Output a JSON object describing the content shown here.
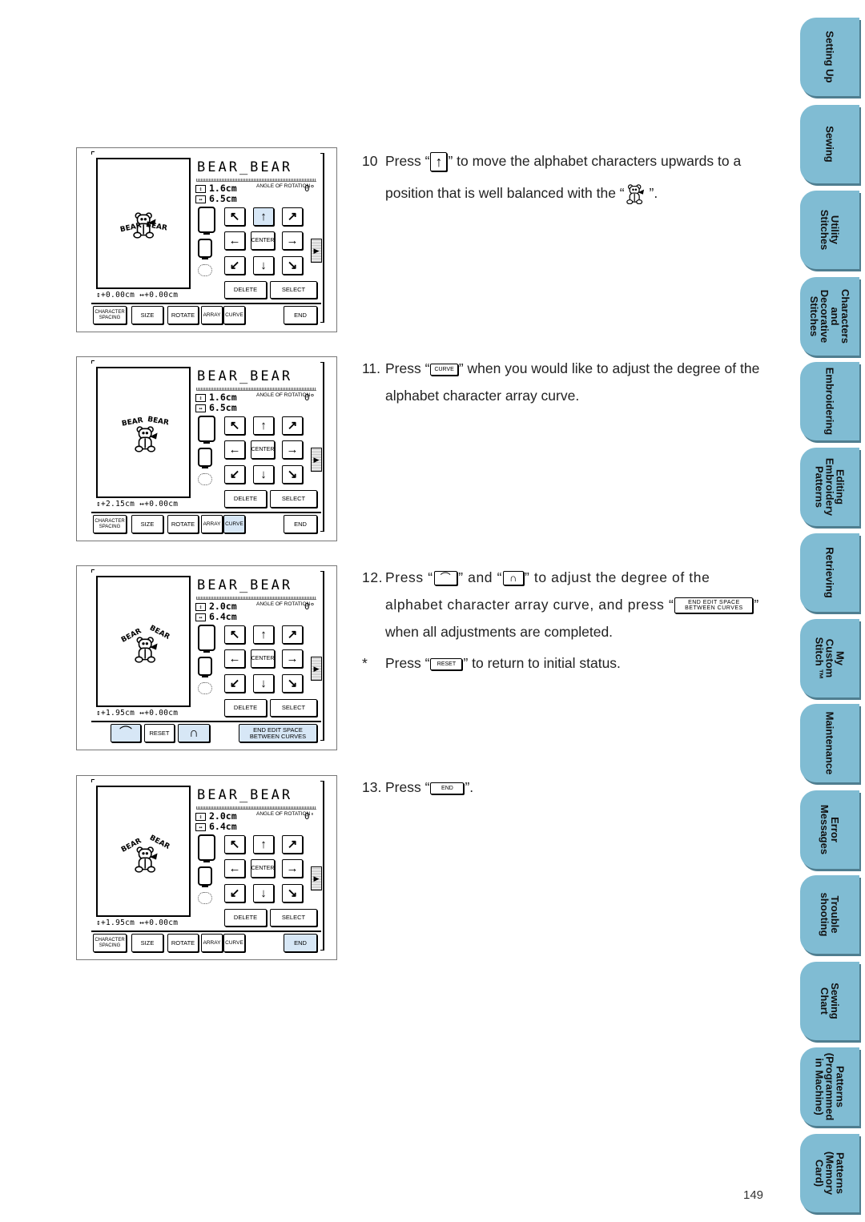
{
  "screens": [
    {
      "title": "BEAR_BEAR",
      "height": "1.6cm",
      "width": "6.5cm",
      "angle_label": "ANGLE OF ROTATION",
      "angle": "0°",
      "offsets": "↕+0.00cm ↔+0.00cm",
      "preview_text": "BEAR BEAR",
      "preview_state": "overlapping",
      "active_button": "up",
      "bottom_mode": "edit"
    },
    {
      "title": "BEAR_BEAR",
      "height": "1.6cm",
      "width": "6.5cm",
      "angle_label": "ANGLE OF ROTATION",
      "angle": "0°",
      "offsets": "↕+2.15cm ↔+0.00cm",
      "preview_text": "BEAR BEAR",
      "preview_state": "above",
      "active_button": "curve",
      "bottom_mode": "edit"
    },
    {
      "title": "BEAR_BEAR",
      "height": "2.0cm",
      "width": "6.4cm",
      "angle_label": "ANGLE OF ROTATION",
      "angle": "0°",
      "offsets": "↕+1.95cm ↔+0.00cm",
      "preview_text": "BEAR BEAR",
      "preview_state": "curved",
      "active_button": "curve-adjust",
      "bottom_mode": "curve"
    },
    {
      "title": "BEAR_BEAR",
      "height": "2.0cm",
      "width": "6.4cm",
      "angle_label": "ANGLE OF ROTATION",
      "angle": "0'",
      "offsets": "↕+1.95cm ↔+0.00cm",
      "preview_text": "BEAR BEAR",
      "preview_state": "curved",
      "active_button": "end",
      "bottom_mode": "edit"
    }
  ],
  "buttons": {
    "center": "CENTER",
    "delete": "DELETE",
    "select": "SELECT",
    "char_spacing": "CHARACTER SPACING",
    "size": "SIZE",
    "rotate": "ROTATE",
    "array": "ARRAY",
    "curve": "CURVE",
    "end": "END",
    "reset": "RESET",
    "end_edit": "END EDIT SPACE BETWEEN CURVES",
    "arrows": {
      "up_left": "↖",
      "up": "↑",
      "up_right": "↗",
      "left": "←",
      "right": "→",
      "down_left": "↙",
      "down": "↓",
      "down_right": "↘"
    },
    "scroll_right": "▶",
    "curve_less_icon": "⌒",
    "curve_more_icon": "∩"
  },
  "steps": [
    {
      "num": "10",
      "pre": "Press “",
      "key": "↑",
      "post": "” to move the alphabet characters upwards to a",
      "line2": "position that is well balanced with the “ ”.",
      "line2_icon": "bear-icon"
    },
    {
      "num": "11.",
      "pre": "Press “",
      "key": "CURVE",
      "post": "” when you would like to adjust the degree of the",
      "line2": "alphabet character array curve."
    },
    {
      "num": "12.",
      "pre": "Press “",
      "key": "⌒",
      "mid": "” and “",
      "key2": "∩",
      "post": "” to adjust the degree of the",
      "line2_pre": "alphabet character array curve, and press “",
      "line2_key": "END EDIT SPACE BETWEEN CURVES",
      "line2_post": "”",
      "line3": "when all adjustments are completed."
    },
    {
      "num": "13.",
      "pre": "Press “",
      "key": "END",
      "post": "”."
    }
  ],
  "note": {
    "marker": "*",
    "pre": "Press “",
    "key": "RESET",
    "post": "” to return to initial status."
  },
  "side_tabs": [
    "Setting Up",
    "Sewing",
    "Utility\nStitches",
    "Characters\nand\nDecorative\nStitches",
    "Embroidering",
    "Editing\nEmbroidery\nPatterns",
    "Retrieving",
    "My\nCustom\nStitch ™",
    "Maintenance",
    "Error\nMessages",
    "Trouble\nshooting",
    "Sewing\nChart",
    "Patterns\n(Programmed\nin Machine)",
    "Patterns\n(Memory\nCard)"
  ],
  "colors": {
    "tab_fill": "#80bcd3",
    "tab_shadow": "#4f7e90",
    "active_button": "#d7e7f6"
  },
  "page_number": "149"
}
